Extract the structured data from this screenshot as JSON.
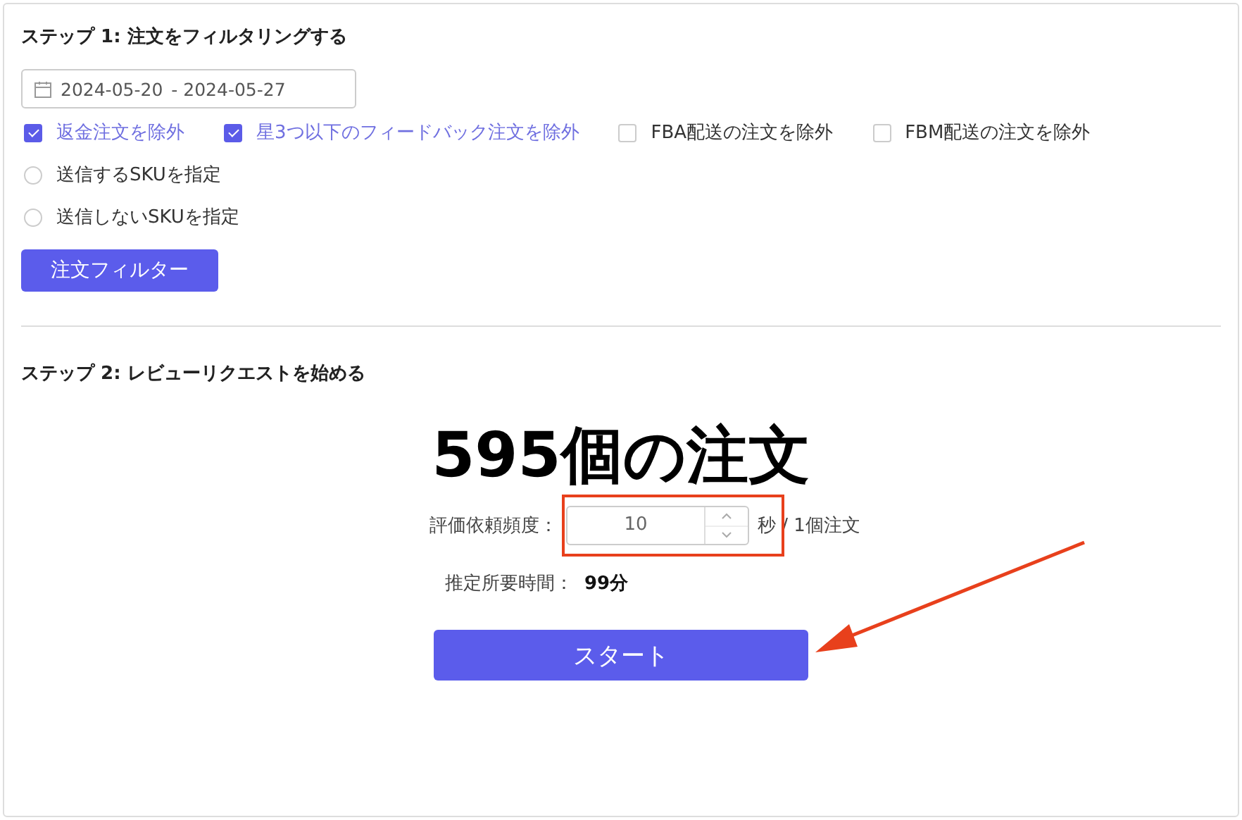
{
  "step1": {
    "title": "ステップ 1: 注文をフィルタリングする",
    "date_range": {
      "start": "2024-05-20",
      "end": "- 2024-05-27"
    },
    "checkboxes": [
      {
        "label": "返金注文を除外",
        "checked": true
      },
      {
        "label": "星3つ以下のフィードバック注文を除外",
        "checked": true
      },
      {
        "label": "FBA配送の注文を除外",
        "checked": false
      },
      {
        "label": "FBM配送の注文を除外",
        "checked": false
      }
    ],
    "radios": [
      {
        "label": "送信するSKUを指定",
        "selected": false
      },
      {
        "label": "送信しないSKUを指定",
        "selected": false
      }
    ],
    "filter_button": "注文フィルター"
  },
  "step2": {
    "title": "ステップ 2: レビューリクエストを始める",
    "order_count": "595個の注文",
    "frequency": {
      "label": "評価依頼頻度：",
      "value": "10",
      "unit": "秒 / 1個注文"
    },
    "estimate": {
      "label": "推定所要時間：",
      "value": "99分"
    },
    "start_button": "スタート"
  }
}
